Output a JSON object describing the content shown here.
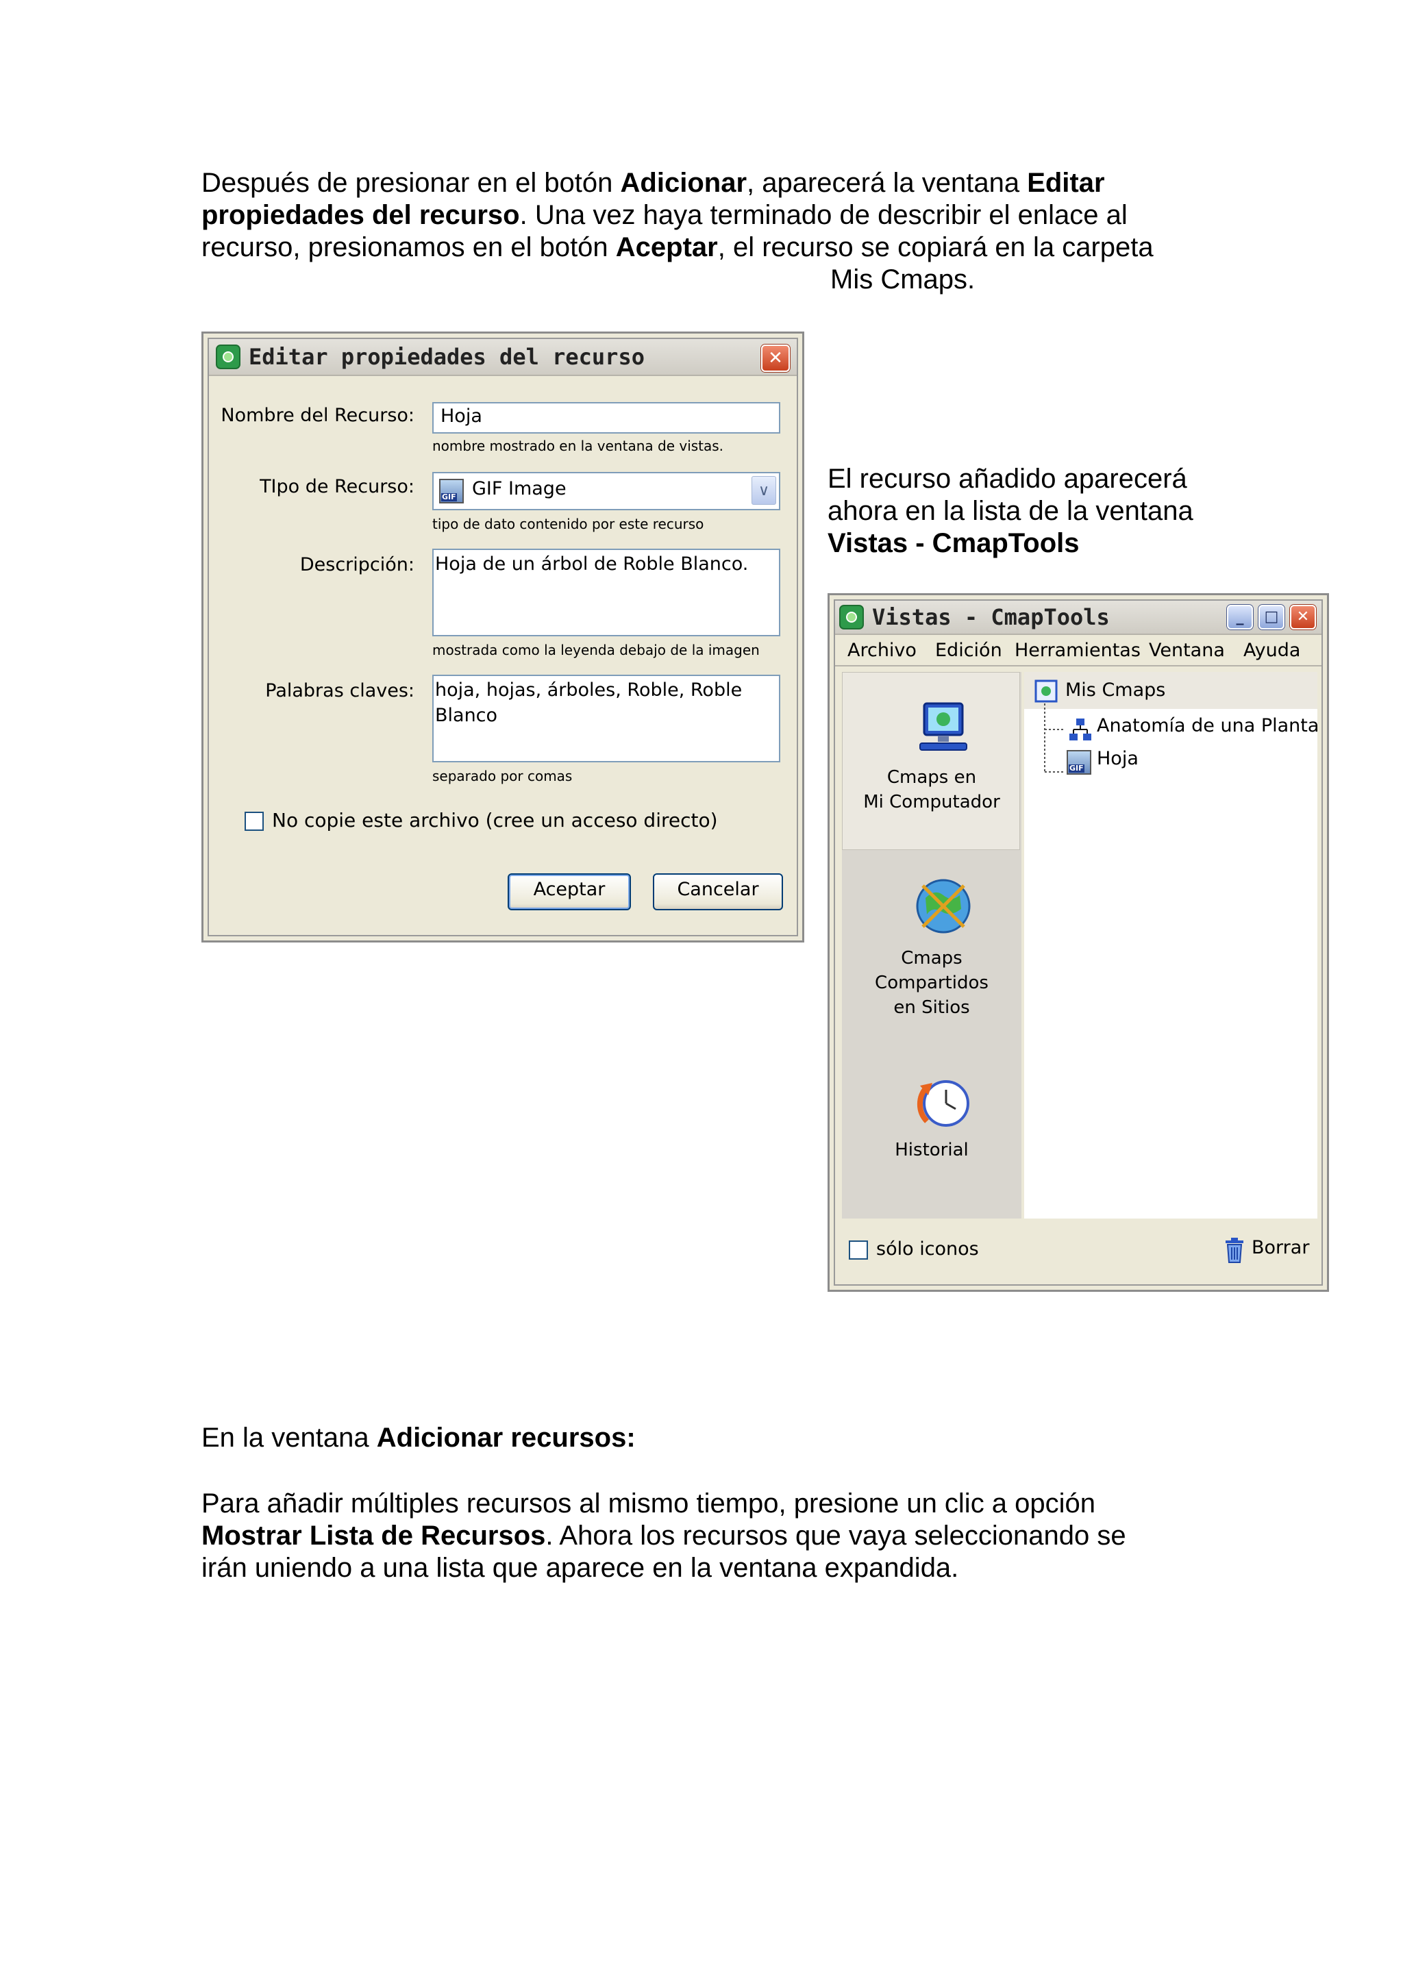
{
  "intro": {
    "t1": "Después de presionar en el botón ",
    "b1": "Adicionar",
    "t2": ", aparecerá la ventana ",
    "b2": "Editar",
    "b3": "propiedades del recurso",
    "t3": ". Una vez haya terminado de describir el enlace al",
    "t4": "recurso, presionamos en el botón ",
    "b4": "Aceptar",
    "t5": ", el recurso se copiará en la carpeta",
    "t6": "Mis Cmaps."
  },
  "dialog": {
    "title": "Editar propiedades del recurso",
    "close_glyph": "✕",
    "name_label": "Nombre del Recurso:",
    "name_value": "Hoja",
    "name_hint": "nombre mostrado en la ventana de vistas.",
    "type_label": "TIpo de Recurso:",
    "type_value": "GIF Image",
    "type_icon_text": "GIF",
    "type_hint": "tipo de dato contenido por este recurso",
    "desc_label": "Descripción:",
    "desc_value": "Hoja de un árbol de Roble Blanco.",
    "desc_hint": "mostrada como la leyenda debajo de la imagen",
    "keywords_label": "Palabras claves:",
    "keywords_value": "hoja, hojas, árboles, Roble, Roble Blanco",
    "keywords_hint": "separado por comas",
    "nocopy_label": "No copie este archivo  (cree un acceso directo)",
    "accept_label": "Aceptar",
    "cancel_label": "Cancelar"
  },
  "side_text": {
    "l1": "El recurso añadido aparecerá",
    "l2": "ahora en la lista de la ventana",
    "l3": "Vistas - CmapTools"
  },
  "window": {
    "title": "Vistas - CmapTools",
    "min_glyph": "_",
    "max_glyph": "□",
    "close_glyph": "✕",
    "menu": [
      "Archivo",
      "Edición",
      "Herramientas",
      "Ventana",
      "Ayuda"
    ],
    "side_items": [
      {
        "l1": "Cmaps en",
        "l2": "Mi Computador"
      },
      {
        "l1": "Cmaps Compartidos",
        "l2": "en Sitios"
      },
      {
        "l1": "Historial"
      }
    ],
    "tree": {
      "root": "Mis Cmaps",
      "children": [
        "Anatomía de una Planta",
        "Hoja"
      ],
      "gif_text": "GIF"
    },
    "icons_only_label": "sólo iconos",
    "delete_label": "Borrar"
  },
  "section": {
    "t1": "En la ventana ",
    "b1": "Adicionar recursos:",
    "t2": "Para añadir múltiples recursos al mismo tiempo, presione un clic a opción",
    "b2": "Mostrar Lista de Recursos",
    "t3": ". Ahora los recursos que vaya seleccionando se",
    "t4": "irán uniendo a una lista que aparece en la ventana expandida."
  },
  "colors": {
    "window_face": "#ece9d8",
    "xp_border_blue": "#7f9db9",
    "close_red": "#c8401e"
  }
}
